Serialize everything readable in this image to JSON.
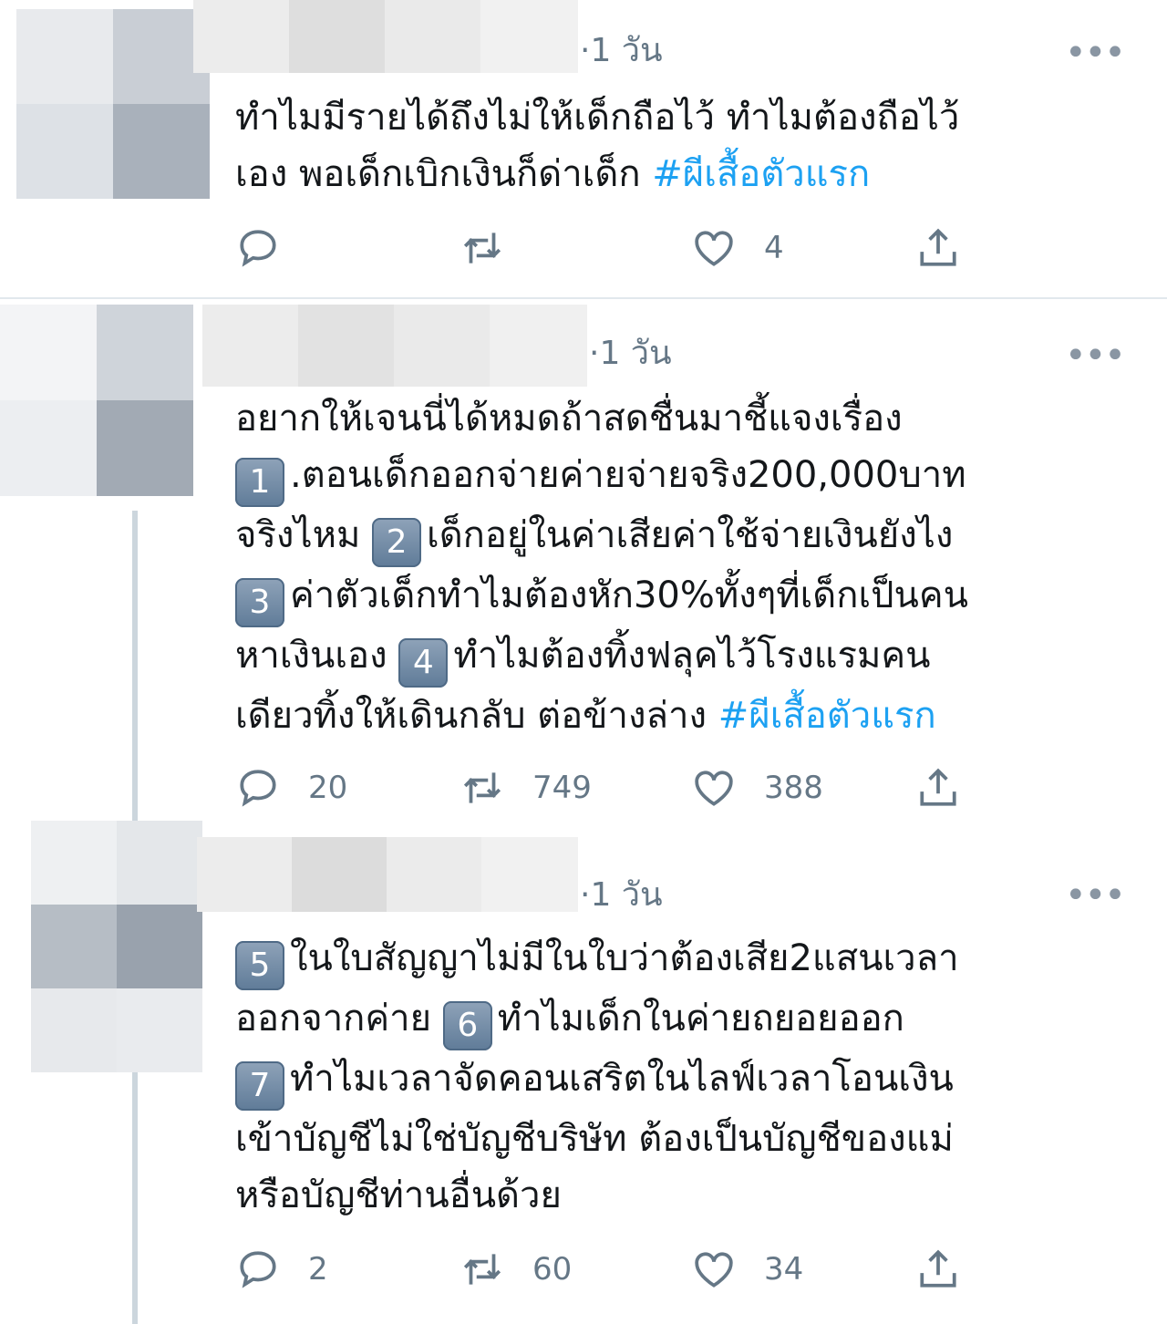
{
  "tweets": [
    {
      "time": "·1 วัน",
      "more": "•••",
      "lines": [
        [
          {
            "t": "ทำไมมีรายได้ถึงไม่ให้เด็กถือไว้ ทำไมต้องถือไว้"
          }
        ],
        [
          {
            "t": "เอง พอเด็กเบิกเงินก็ด่าเด็ก "
          },
          {
            "h": "#ผีเสื้อตัวแรก"
          }
        ]
      ],
      "reply_count": "",
      "retweet_count": "",
      "like_count": "4"
    },
    {
      "time": "·1 วัน",
      "more": "•••",
      "lines": [
        [
          {
            "t": "อยากให้เจนนี่ได้หมดถ้าสดชื่นมาชี้แจงเรื่อง"
          }
        ],
        [
          {
            "n": "1"
          },
          {
            "t": ".ตอนเด็กออกจ่ายค่ายจ่ายจริง200,000บาท"
          }
        ],
        [
          {
            "t": "จริงไหม "
          },
          {
            "n": "2"
          },
          {
            "t": "เด็กอยู่ในค่าเสียค่าใช้จ่ายเงินยังไง"
          }
        ],
        [
          {
            "n": "3"
          },
          {
            "t": "ค่าตัวเด็กทำไมต้องหัก30%ทั้งๆที่เด็กเป็นคน"
          }
        ],
        [
          {
            "t": "หาเงินเอง  "
          },
          {
            "n": "4"
          },
          {
            "t": "ทำไมต้องทิ้งฟลุคไว้โรงแรมคน"
          }
        ],
        [
          {
            "t": "เดียวทิ้งให้เดินกลับ ต่อข้างล่าง "
          },
          {
            "h": "#ผีเสื้อตัวแรก"
          }
        ]
      ],
      "reply_count": "20",
      "retweet_count": "749",
      "like_count": "388"
    },
    {
      "time": "·1 วัน",
      "more": "•••",
      "lines": [
        [
          {
            "n": "5"
          },
          {
            "t": "ในใบสัญญาไม่มีในใบว่าต้องเสีย2แสนเวลา"
          }
        ],
        [
          {
            "t": "ออกจากค่าย "
          },
          {
            "n": "6"
          },
          {
            "t": "ทำไมเด็กในค่ายถยอยออก"
          }
        ],
        [
          {
            "n": "7"
          },
          {
            "t": "ทำไมเวลาจัดคอนเสริตในไลฟ์เวลาโอนเงิน"
          }
        ],
        [
          {
            "t": "เข้าบัญชีไม่ใช่บัญชีบริษัท ต้องเป็นบัญชีของแม่"
          }
        ],
        [
          {
            "t": "หรือบัญชีท่านอื่นด้วย"
          }
        ]
      ],
      "reply_count": "2",
      "retweet_count": "60",
      "like_count": "34"
    }
  ]
}
